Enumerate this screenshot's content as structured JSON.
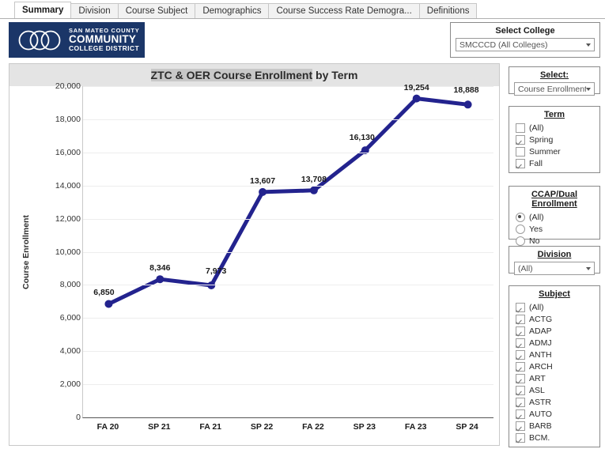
{
  "tabs": [
    {
      "label": "Summary",
      "active": true
    },
    {
      "label": "Division",
      "active": false
    },
    {
      "label": "Course Subject",
      "active": false
    },
    {
      "label": "Demographics",
      "active": false
    },
    {
      "label": "Course Success Rate Demogra...",
      "active": false
    },
    {
      "label": "Definitions",
      "active": false
    }
  ],
  "logo": {
    "line1": "SAN MATEO COUNTY",
    "line2": "COMMUNITY",
    "line3": "COLLEGE DISTRICT",
    "bg": "#1b3668"
  },
  "filters": {
    "college": {
      "title": "Select College",
      "value": "SMCCCD (All Colleges)"
    },
    "measure": {
      "title": "Select:",
      "value": "Course Enrollment"
    },
    "term": {
      "title": "Term",
      "items": [
        {
          "label": "(All)",
          "checked": false
        },
        {
          "label": "Spring",
          "checked": true
        },
        {
          "label": "Summer",
          "checked": false
        },
        {
          "label": "Fall",
          "checked": true
        }
      ]
    },
    "ccap": {
      "title": "CCAP/Dual Enrollment",
      "items": [
        {
          "label": "(All)",
          "selected": true
        },
        {
          "label": "Yes",
          "selected": false
        },
        {
          "label": "No",
          "selected": false
        }
      ]
    },
    "division": {
      "title": "Division",
      "value": "(All)"
    },
    "subject": {
      "title": "Subject",
      "items": [
        {
          "label": "(All)",
          "checked": true
        },
        {
          "label": "ACTG",
          "checked": true
        },
        {
          "label": "ADAP",
          "checked": true
        },
        {
          "label": "ADMJ",
          "checked": true
        },
        {
          "label": "ANTH",
          "checked": true
        },
        {
          "label": "ARCH",
          "checked": true
        },
        {
          "label": "ART",
          "checked": true
        },
        {
          "label": "ASL",
          "checked": true
        },
        {
          "label": "ASTR",
          "checked": true
        },
        {
          "label": "AUTO",
          "checked": true
        },
        {
          "label": "BARB",
          "checked": true
        },
        {
          "label": "BCM.",
          "checked": true
        }
      ]
    }
  },
  "chart_data": {
    "type": "line",
    "title": "ZTC & OER Course Enrollment by Term",
    "title_highlight": "ZTC & OER Course Enrollment",
    "title_rest": " by Term",
    "xlabel": "",
    "ylabel": "Course Enrollment",
    "categories": [
      "FA 20",
      "SP 21",
      "FA 21",
      "SP 22",
      "FA 22",
      "SP 23",
      "FA 23",
      "SP 24"
    ],
    "values": [
      6850,
      8346,
      7973,
      13607,
      13708,
      16130,
      19254,
      18888
    ],
    "labels": [
      "6,850",
      "8,346",
      "7,973",
      "13,607",
      "13,708",
      "16,130",
      "19,254",
      "18,888"
    ],
    "ylim": [
      0,
      20000
    ],
    "yticks": [
      20000,
      18000,
      16000,
      14000,
      12000,
      10000,
      8000,
      6000,
      4000,
      2000,
      0
    ],
    "ytick_labels": [
      "20,000",
      "18,000",
      "16,000",
      "14,000",
      "12,000",
      "10,000",
      "8,000",
      "6,000",
      "4,000",
      "2,000",
      "0"
    ],
    "grid": true,
    "legend": "none",
    "series_color": "#23238e"
  }
}
